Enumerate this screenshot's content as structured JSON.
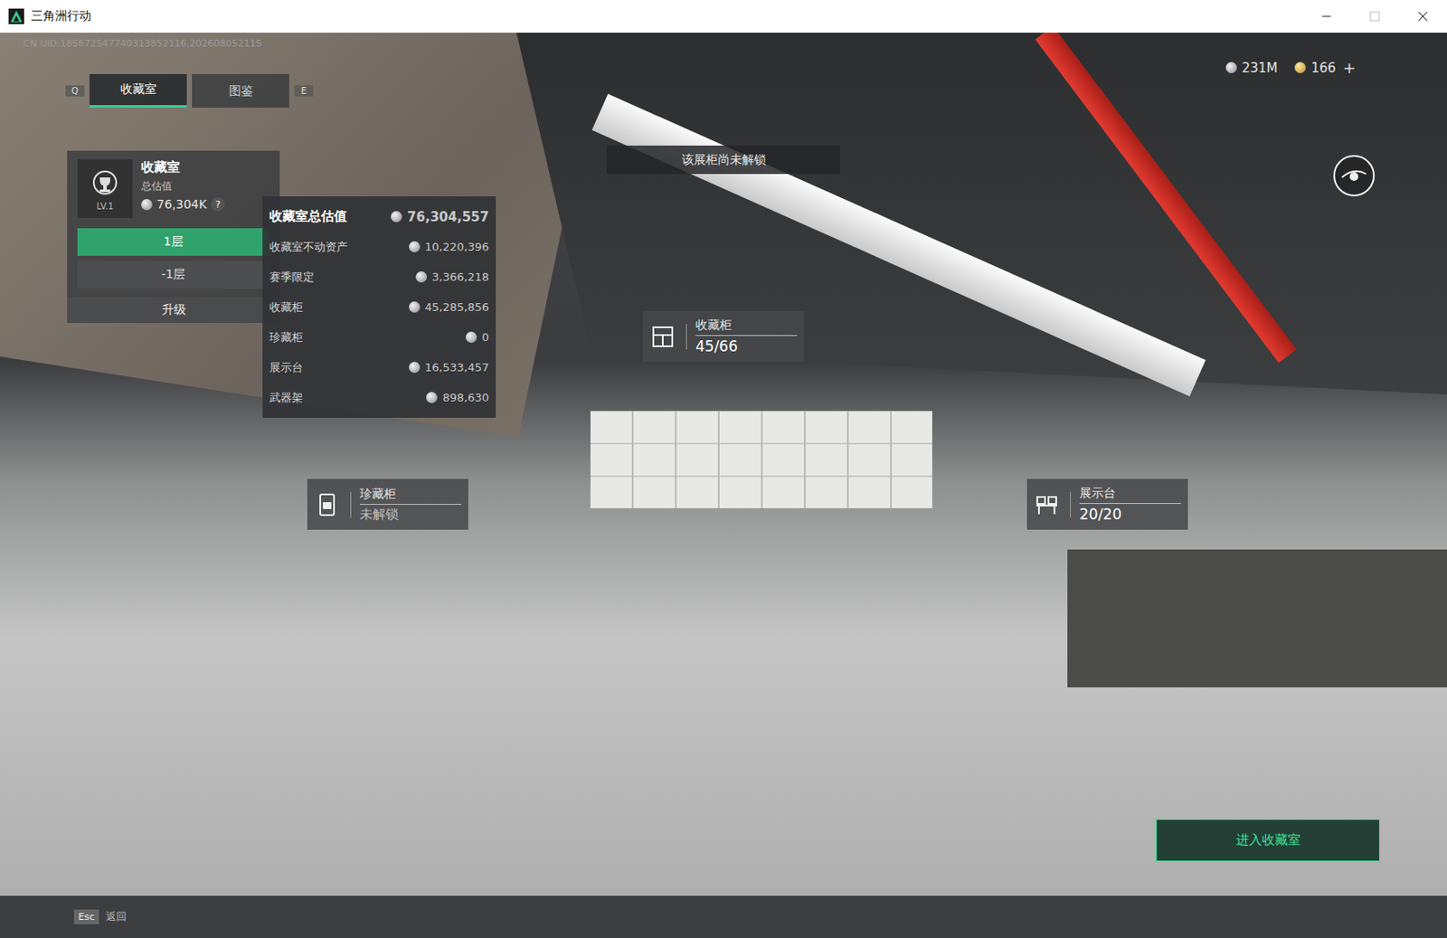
{
  "window": {
    "title": "三角洲行动",
    "uid": "CN UID:185672547740313852116,202608052115"
  },
  "tabs": {
    "prev_key": "Q",
    "next_key": "E",
    "items": [
      {
        "label": "收藏室",
        "selected": true
      },
      {
        "label": "图鉴",
        "selected": false
      }
    ]
  },
  "currency": [
    {
      "amount": "231M",
      "kind": "silver"
    },
    {
      "amount": "166",
      "kind": "gold"
    }
  ],
  "currency_add": "+",
  "room_panel": {
    "title": "收藏室",
    "value_label": "总估值",
    "value": "76,304K",
    "help": "?",
    "level": "LV.1",
    "floors": [
      {
        "label": "1层",
        "selected": true
      },
      {
        "label": "-1层",
        "selected": false
      }
    ],
    "upgrade": "升级"
  },
  "breakdown": {
    "title": "收藏室总估值",
    "total": "76,304,557",
    "rows": [
      {
        "label": "收藏室不动资产",
        "value": "10,220,396"
      },
      {
        "label": "赛季限定",
        "value": "3,366,218"
      },
      {
        "label": "收藏柜",
        "value": "45,285,856"
      },
      {
        "label": "珍藏柜",
        "value": "0"
      },
      {
        "label": "展示台",
        "value": "16,533,457"
      },
      {
        "label": "武器架",
        "value": "898,630"
      }
    ]
  },
  "banner": "该展柜尚未解锁",
  "markers": [
    {
      "name": "收藏柜",
      "status": "45/66",
      "locked": false,
      "kind": "cabinet"
    },
    {
      "name": "珍藏柜",
      "status": "未解锁",
      "locked": true,
      "kind": "vault"
    },
    {
      "name": "展示台",
      "status": "20/20",
      "locked": false,
      "kind": "stand"
    }
  ],
  "enter_button": "进入收藏室",
  "footer": {
    "key": "Esc",
    "label": "返回"
  }
}
